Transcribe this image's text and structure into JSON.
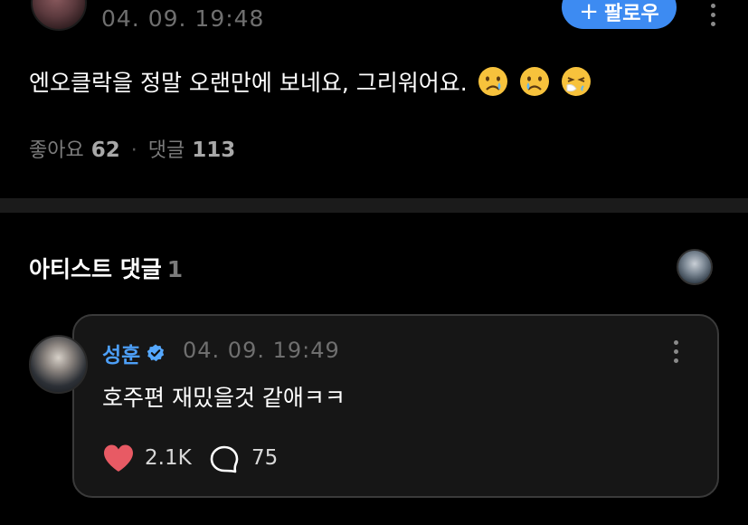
{
  "post": {
    "time": "04. 09. 19:48",
    "follow_label": "팔로우",
    "body": "엔오클락을 정말 오랜만에 보네요, 그리워어요.",
    "emojis": [
      "crying-face",
      "crying-face",
      "sneezing-face"
    ],
    "likes_label": "좋아요",
    "likes_count": "62",
    "comments_label": "댓글",
    "comments_count": "113"
  },
  "artist_comments": {
    "title": "아티스트 댓글",
    "count": "1",
    "comment": {
      "author": "성훈",
      "verified": true,
      "time": "04. 09. 19:49",
      "text": "호주편 재밌을것 같애ㅋㅋ",
      "likes": "2.1K",
      "replies": "75"
    }
  },
  "colors": {
    "background": "#000000",
    "accent_blue": "#3d8bf2",
    "author_blue": "#4d9ff7",
    "verified_badge": "#55a8ff",
    "heart_red": "#e85a64",
    "muted_text": "#7b7b7b",
    "card_bg": "#161616"
  }
}
